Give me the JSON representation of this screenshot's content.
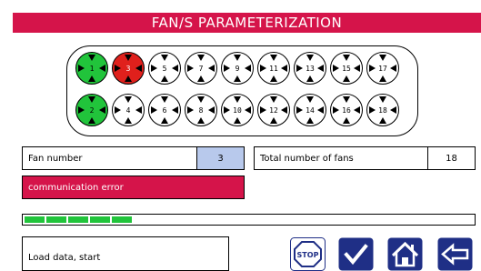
{
  "title": "FAN/S PARAMETERIZATION",
  "fans": {
    "top_row": [
      {
        "number": "1",
        "state": "ok"
      },
      {
        "number": "3",
        "state": "error"
      },
      {
        "number": "5",
        "state": "idle"
      },
      {
        "number": "7",
        "state": "idle"
      },
      {
        "number": "9",
        "state": "idle"
      },
      {
        "number": "11",
        "state": "idle"
      },
      {
        "number": "13",
        "state": "idle"
      },
      {
        "number": "15",
        "state": "idle"
      },
      {
        "number": "17",
        "state": "idle"
      }
    ],
    "bottom_row": [
      {
        "number": "2",
        "state": "ok"
      },
      {
        "number": "4",
        "state": "idle"
      },
      {
        "number": "6",
        "state": "idle"
      },
      {
        "number": "8",
        "state": "idle"
      },
      {
        "number": "10",
        "state": "idle"
      },
      {
        "number": "12",
        "state": "idle"
      },
      {
        "number": "14",
        "state": "idle"
      },
      {
        "number": "16",
        "state": "idle"
      },
      {
        "number": "18",
        "state": "idle"
      }
    ]
  },
  "fan_number": {
    "label": "Fan number",
    "value": "3"
  },
  "total_fans": {
    "label": "Total number of fans",
    "value": "18"
  },
  "error_message": "communication error",
  "progress": {
    "fraction": 0.24,
    "segments_filled": 5
  },
  "status_text": "Load data, start",
  "buttons": {
    "stop": {
      "label": "STOP",
      "icon": "stop-icon"
    },
    "confirm": {
      "icon": "checkmark-icon"
    },
    "home": {
      "icon": "home-icon"
    },
    "back": {
      "icon": "back-arrow-icon"
    }
  },
  "colors": {
    "accent": "#d5144a",
    "ok": "#21c43b",
    "error": "#e0201c",
    "selected_field": "#b8c9ec",
    "button_blue": "#1f2f86"
  }
}
